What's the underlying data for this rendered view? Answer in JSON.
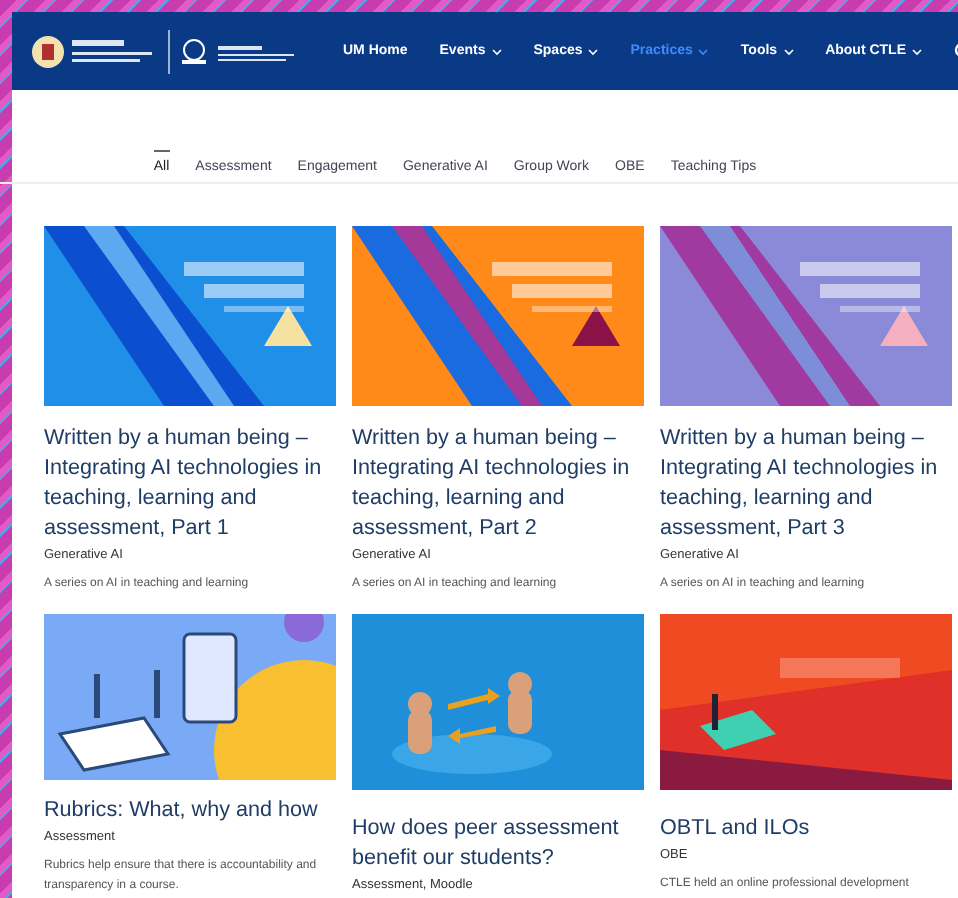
{
  "nav": {
    "items": [
      {
        "label": "UM Home",
        "dropdown": false,
        "selected": false
      },
      {
        "label": "Events",
        "dropdown": true,
        "selected": false
      },
      {
        "label": "Spaces",
        "dropdown": true,
        "selected": false
      },
      {
        "label": "Practices",
        "dropdown": true,
        "selected": true
      },
      {
        "label": "Tools",
        "dropdown": true,
        "selected": false
      },
      {
        "label": "About CTLE",
        "dropdown": true,
        "selected": false
      }
    ]
  },
  "filters": [
    {
      "label": "All",
      "selected": true
    },
    {
      "label": "Assessment",
      "selected": false
    },
    {
      "label": "Engagement",
      "selected": false
    },
    {
      "label": "Generative AI",
      "selected": false
    },
    {
      "label": "Group Work",
      "selected": false
    },
    {
      "label": "OBE",
      "selected": false
    },
    {
      "label": "Teaching Tips",
      "selected": false
    }
  ],
  "cards": [
    {
      "title": "Written by a human being – Integrating AI technologies in teaching, learning and assessment, Part 1",
      "category": "Generative AI",
      "excerpt": "A series on AI in teaching and learning"
    },
    {
      "title": "Written by a human being – Integrating AI technologies in teaching, learning and assessment, Part 2",
      "category": "Generative AI",
      "excerpt": "A series on AI in teaching and learning"
    },
    {
      "title": "Written by a human being – Integrating AI technologies in teaching, learning and assessment, Part 3",
      "category": "Generative AI",
      "excerpt": "A series on AI in teaching and learning"
    },
    {
      "title": "Rubrics: What, why and how",
      "category": "Assessment",
      "excerpt": "Rubrics help ensure that there is accountability and transparency in a course."
    },
    {
      "title": "How does peer assessment benefit our students?",
      "category": "Assessment, Moodle"
    },
    {
      "title": "OBTL and ILOs",
      "category": "OBE",
      "excerpt": "CTLE held an online professional development"
    }
  ]
}
